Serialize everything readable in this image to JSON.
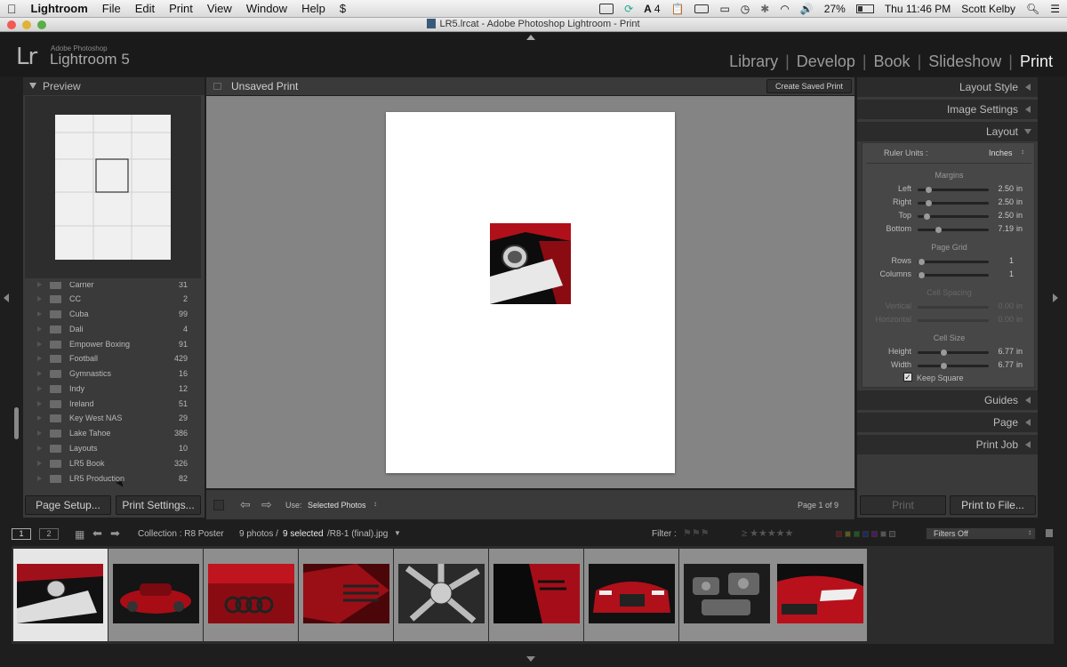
{
  "menubar": {
    "app": "Lightroom",
    "items": [
      "File",
      "Edit",
      "Print",
      "View",
      "Window",
      "Help"
    ],
    "status_number": "4",
    "battery": "27%",
    "clock": "Thu 11:46 PM",
    "user": "Scott Kelby"
  },
  "window": {
    "title": "LR5.lrcat - Adobe Photoshop Lightroom - Print"
  },
  "lr": {
    "logo": "Lr",
    "brand_small": "Adobe Photoshop",
    "brand": "Lightroom 5",
    "modules": [
      "Library",
      "Develop",
      "Book",
      "Slideshow",
      "Print"
    ],
    "active_module": "Print"
  },
  "left": {
    "preview_title": "Preview",
    "folders": [
      {
        "name": "Carrier",
        "count": "31"
      },
      {
        "name": "CC",
        "count": "2"
      },
      {
        "name": "Cuba",
        "count": "99"
      },
      {
        "name": "Dali",
        "count": "4"
      },
      {
        "name": "Empower Boxing",
        "count": "91"
      },
      {
        "name": "Football",
        "count": "429"
      },
      {
        "name": "Gymnastics",
        "count": "16"
      },
      {
        "name": "Indy",
        "count": "12"
      },
      {
        "name": "Ireland",
        "count": "51"
      },
      {
        "name": "Key West NAS",
        "count": "29"
      },
      {
        "name": "Lake Tahoe",
        "count": "386"
      },
      {
        "name": "Layouts",
        "count": "10"
      },
      {
        "name": "LR5 Book",
        "count": "326"
      },
      {
        "name": "LR5 Production",
        "count": "82"
      }
    ],
    "page_setup": "Page Setup...",
    "print_settings": "Print Settings..."
  },
  "center": {
    "title": "Unsaved Print",
    "create_saved": "Create Saved Print",
    "use_label": "Use:",
    "use_value": "Selected Photos",
    "page_info": "Page 1 of 9"
  },
  "right": {
    "layout_style": "Layout Style",
    "image_settings": "Image Settings",
    "layout": "Layout",
    "ruler_units_label": "Ruler Units :",
    "ruler_units_value": "Inches",
    "margins_title": "Margins",
    "margins": [
      {
        "label": "Left",
        "value": "2.50",
        "unit": "in",
        "fraction": 0.12
      },
      {
        "label": "Right",
        "value": "2.50",
        "unit": "in",
        "fraction": 0.12
      },
      {
        "label": "Top",
        "value": "2.50",
        "unit": "in",
        "fraction": 0.1
      },
      {
        "label": "Bottom",
        "value": "7.19",
        "unit": "in",
        "fraction": 0.27
      }
    ],
    "page_grid_title": "Page Grid",
    "grid": [
      {
        "label": "Rows",
        "value": "1",
        "fraction": 0.02
      },
      {
        "label": "Columns",
        "value": "1",
        "fraction": 0.02
      }
    ],
    "cell_spacing_title": "Cell Spacing",
    "spacing": [
      {
        "label": "Vertical",
        "value": "0.00",
        "unit": "in"
      },
      {
        "label": "Horizontal",
        "value": "0.00",
        "unit": "in"
      }
    ],
    "cell_size_title": "Cell Size",
    "cell_size": [
      {
        "label": "Height",
        "value": "6.77",
        "unit": "in",
        "fraction": 0.36
      },
      {
        "label": "Width",
        "value": "6.77",
        "unit": "in",
        "fraction": 0.36
      }
    ],
    "keep_square": "Keep Square",
    "guides": "Guides",
    "page": "Page",
    "print_job": "Print Job",
    "print_btn": "Print",
    "print_to_file": "Print to File..."
  },
  "filmstrip": {
    "page1": "1",
    "page2": "2",
    "collection": "Collection : R8 Poster",
    "count_prefix": "9 photos /",
    "selected": "9 selected",
    "filename": "/R8-1 (final).jpg",
    "filter_label": "Filter :",
    "filters_off": "Filters Off"
  },
  "colors": {
    "bg": "#1e1e1e",
    "panel": "#3a3a3a",
    "canvas": "#848484",
    "accent_red": "#c0101a"
  }
}
